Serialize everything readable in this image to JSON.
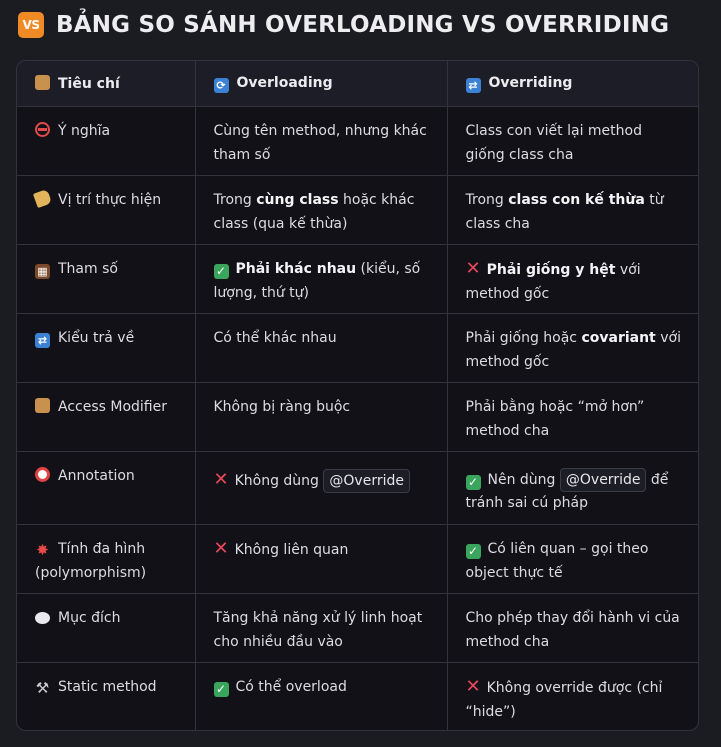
{
  "header": {
    "badge": "VS",
    "title": "BẢNG SO SÁNH OVERLOADING VS OVERRIDING"
  },
  "columns": [
    "Tiêu chí",
    "Overloading",
    "Overriding"
  ],
  "rows": [
    {
      "criterion": "Ý nghĩa",
      "overloading": "Cùng tên method, nhưng khác tham số",
      "overriding": "Class con viết lại method giống class cha"
    },
    {
      "criterion": "Vị trí thực hiện",
      "overloading_pre": "Trong ",
      "overloading_bold": "cùng class",
      "overloading_post": " hoặc khác class (qua kế thừa)",
      "overriding_pre": "Trong ",
      "overriding_bold": "class con kế thừa",
      "overriding_post": " từ class cha"
    },
    {
      "criterion": "Tham số",
      "overloading_bold": "Phải khác nhau",
      "overloading_post": " (kiểu, số lượng, thứ tự)",
      "overriding_bold": "Phải giống y hệt",
      "overriding_post": " với method gốc"
    },
    {
      "criterion": "Kiểu trả về",
      "overloading": "Có thể khác nhau",
      "overriding_pre": "Phải giống hoặc ",
      "overriding_bold": "covariant",
      "overriding_post": " với method gốc"
    },
    {
      "criterion": "Access Modifier",
      "overloading": "Không bị ràng buộc",
      "overriding": "Phải bằng hoặc “mở hơn” method cha"
    },
    {
      "criterion": "Annotation",
      "overloading_pre": "Không dùng ",
      "overloading_code": "@Override",
      "overriding_pre": "Nên dùng ",
      "overriding_code": "@Override",
      "overriding_post": " để tránh sai cú pháp"
    },
    {
      "criterion": "Tính đa hình (polymorphism)",
      "overloading": "Không liên quan",
      "overriding": "Có liên quan – gọi theo object thực tế"
    },
    {
      "criterion": "Mục đích",
      "overloading": "Tăng khả năng xử lý linh hoạt cho nhiều đầu vào",
      "overriding": "Cho phép thay đổi hành vi của method cha"
    },
    {
      "criterion": "Static method",
      "overloading": "Có thể overload",
      "overriding": "Không override được (chỉ “hide”)"
    }
  ],
  "icons": {
    "header_criterion": "package-icon",
    "header_overloading": "sync-icon",
    "header_overriding": "repeat-icon",
    "check": "check-mark-icon",
    "cross": "cross-mark-icon"
  },
  "colors": {
    "background": "#1b1b22",
    "table_bg": "#111117",
    "header_bg": "#1c1d27",
    "accent_orange": "#f08a24",
    "check_green": "#3aa55c",
    "cross_red": "#e8485b"
  }
}
